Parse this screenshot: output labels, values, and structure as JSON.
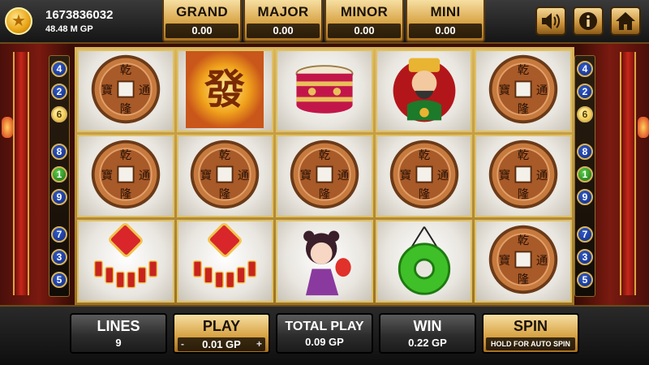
{
  "player": {
    "id": "1673836032",
    "balance": "48.48 M GP",
    "icon": "star-coin-icon"
  },
  "jackpots": [
    {
      "name": "GRAND",
      "value": "0.00"
    },
    {
      "name": "MAJOR",
      "value": "0.00"
    },
    {
      "name": "MINOR",
      "value": "0.00"
    },
    {
      "name": "MINI",
      "value": "0.00"
    }
  ],
  "top_buttons": {
    "sound": "speaker-icon",
    "info": "info-icon",
    "home": "home-icon"
  },
  "paylines_left": [
    "4",
    "2",
    "6",
    "8",
    "1",
    "9",
    "7",
    "3",
    "5"
  ],
  "paylines_right": [
    "4",
    "2",
    "6",
    "8",
    "1",
    "9",
    "7",
    "3",
    "5"
  ],
  "reels": [
    [
      "coin",
      "fa-gold",
      "drum",
      "god-of-wealth",
      "coin"
    ],
    [
      "coin",
      "coin",
      "coin",
      "coin",
      "coin"
    ],
    [
      "firecracker",
      "firecracker",
      "girl-lantern",
      "jade-pendant",
      "coin"
    ]
  ],
  "coin_glyphs": {
    "top": "乾",
    "left": "寶",
    "right": "通",
    "bottom": "隆"
  },
  "fa_glyph": "發",
  "controls": {
    "lines": {
      "label": "LINES",
      "value": "9"
    },
    "play": {
      "label": "PLAY",
      "value": "0.01 GP",
      "minus": "-",
      "plus": "+"
    },
    "total_play": {
      "label": "TOTAL PLAY",
      "value": "0.09 GP"
    },
    "win": {
      "label": "WIN",
      "value": "0.22 GP"
    },
    "spin": {
      "label": "SPIN",
      "sub": "HOLD FOR AUTO SPIN"
    }
  },
  "colors": {
    "gold": "#d9a548",
    "dark_panel": "#2d2d2d",
    "payline_blue": "#2f5ac9"
  }
}
